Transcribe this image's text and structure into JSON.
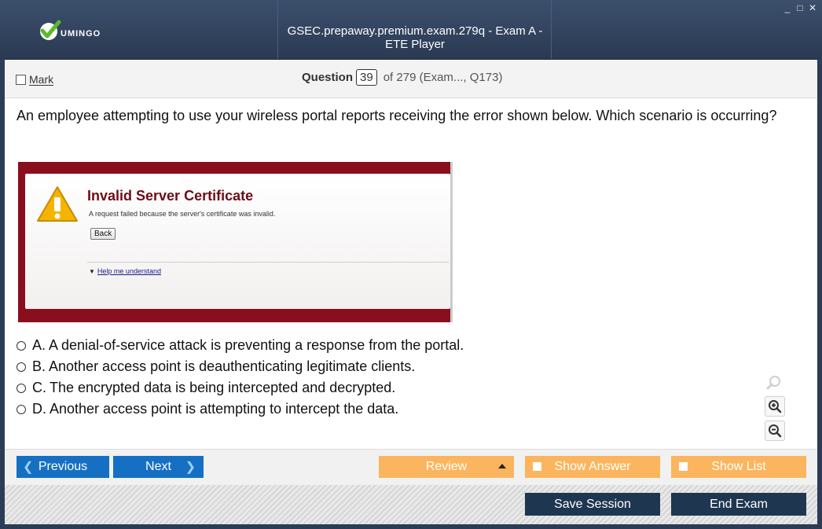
{
  "window": {
    "title": "GSEC.prepaway.premium.exam.279q - Exam A - ETE Player",
    "logo_text": "UMINGO",
    "controls": [
      "_",
      "□",
      "✕"
    ]
  },
  "header": {
    "mark_label": "Mark",
    "question_word": "Question",
    "question_number": "39",
    "question_rest": "of 279 (Exam..., Q173)"
  },
  "question": {
    "stem": "An employee attempting to use your wireless portal reports receiving the error shown below. Which scenario is occurring?",
    "exhibit": {
      "title": "Invalid Server Certificate",
      "message": "A request failed because the server's certificate was invalid.",
      "back_label": "Back",
      "help_label": "Help me understand"
    },
    "answers": [
      {
        "letter": "A.",
        "text": "A denial-of-service attack is preventing a response from the portal."
      },
      {
        "letter": "B.",
        "text": "Another access point is deauthenticating legitimate clients."
      },
      {
        "letter": "C.",
        "text": "The encrypted data is being intercepted and decrypted."
      },
      {
        "letter": "D.",
        "text": "Another access point is attempting to intercept the data."
      }
    ]
  },
  "nav": {
    "previous_label": "Previous",
    "next_label": "Next",
    "review_label": "Review",
    "show_answer_label": "Show Answer",
    "show_list_label": "Show List"
  },
  "footer": {
    "save_label": "Save Session",
    "end_label": "End Exam"
  },
  "colors": {
    "titlebar": "#2f4160",
    "nav_blue": "#1570c4",
    "orange": "#fbb55e",
    "dark_button": "#1f3651",
    "exhibit_red": "#8a0f1e"
  }
}
